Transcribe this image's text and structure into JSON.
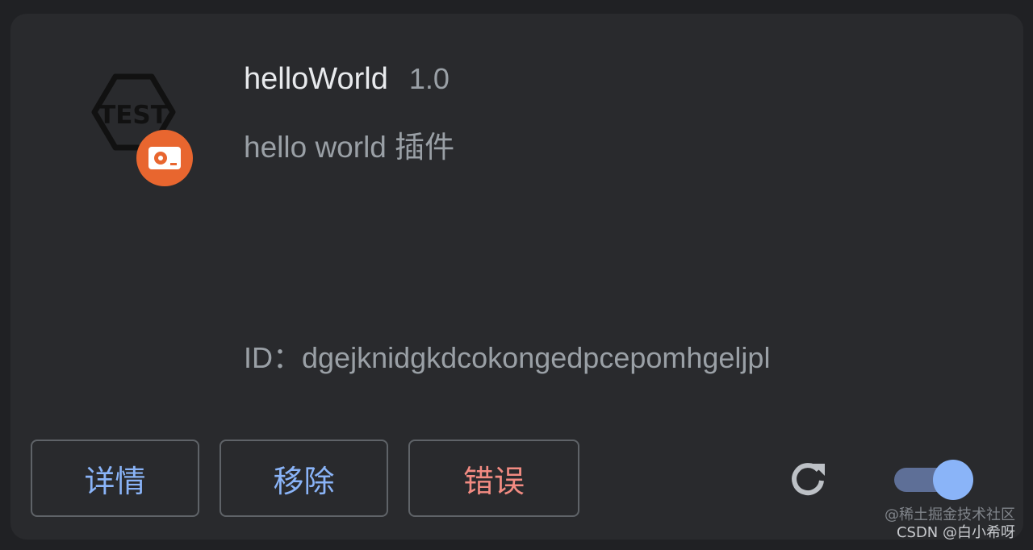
{
  "extension": {
    "icon_text": "TEST",
    "name": "helloWorld",
    "version": "1.0",
    "description": "hello world 插件",
    "id_label": "ID：",
    "id_value": "dgejknidgkdcokongedpcepomhgeljpl"
  },
  "actions": {
    "details_label": "详情",
    "remove_label": "移除",
    "errors_label": "错误"
  },
  "icons": {
    "extension_icon": "hexagon-test-icon",
    "badge": "unpacked-drive-icon",
    "reload": "reload-icon"
  },
  "toggle": {
    "enabled": true
  },
  "colors": {
    "card_bg": "#292a2d",
    "link_blue": "#8ab4f8",
    "error_red": "#f28b82",
    "badge_orange": "#e8662f"
  },
  "watermark": {
    "line1": "@稀土掘金技术社区",
    "line2": "CSDN @白小希呀"
  }
}
